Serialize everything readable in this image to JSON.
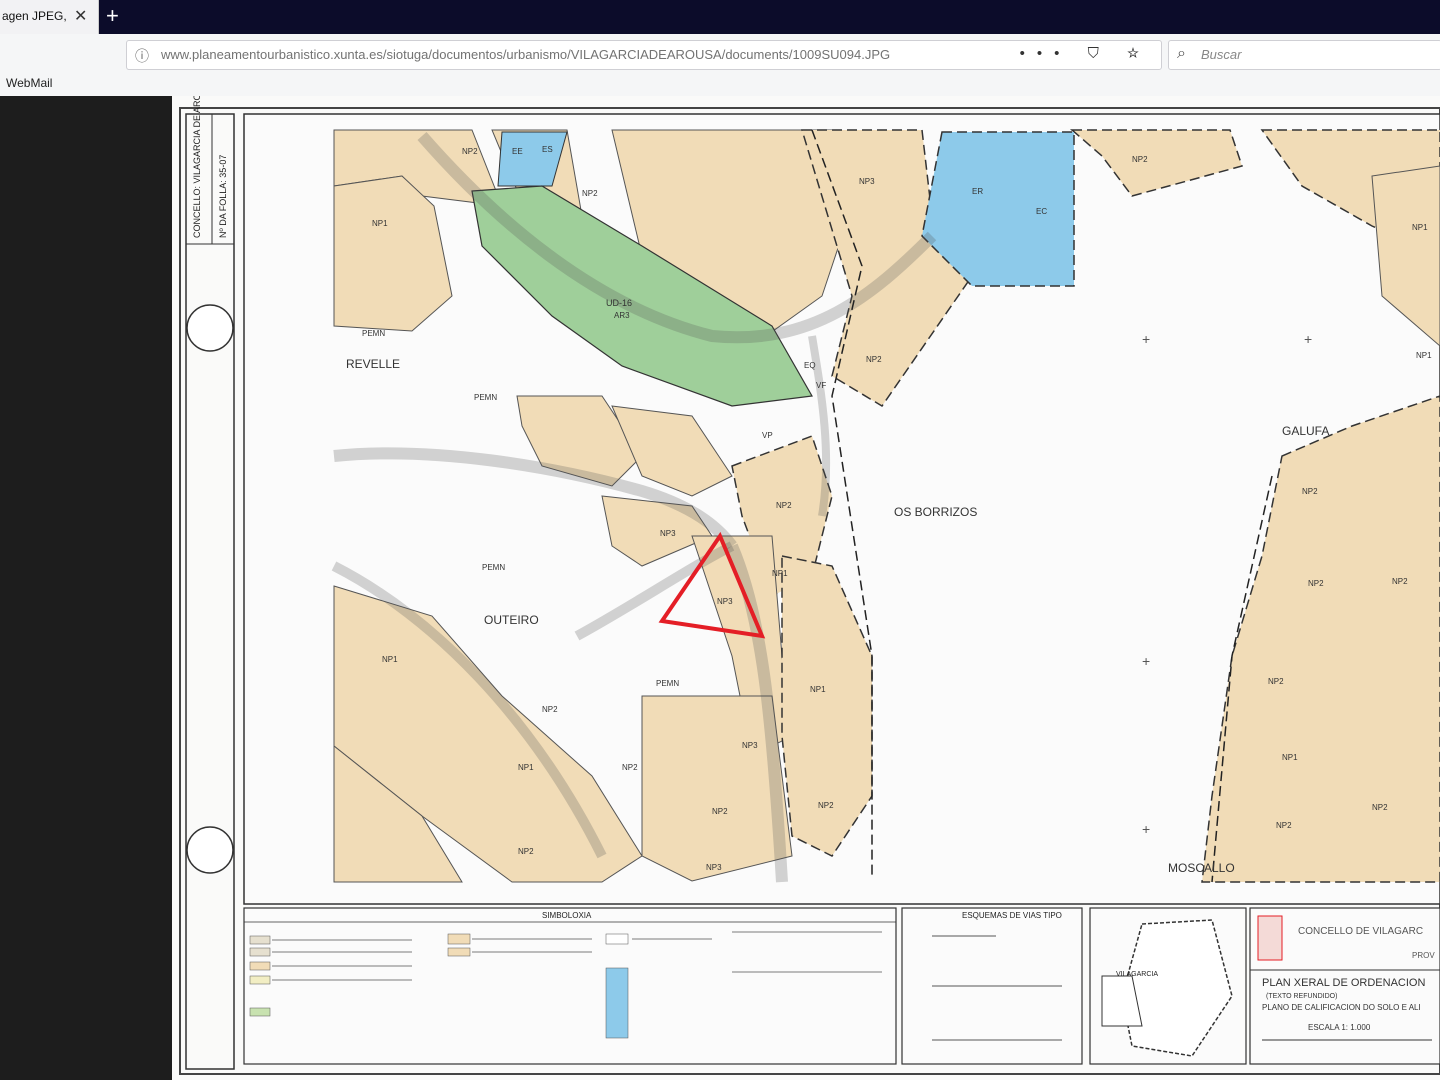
{
  "browser": {
    "tab_title": "agen JPEG,",
    "tab_close": "✕",
    "new_tab": "+",
    "url": "www.planeamentourbanistico.xunta.es/siotuga/documentos/urbanismo/VILAGARCIADEAROUSA/documents/1009SU094.JPG",
    "url_actions": "••• ⛉ ☆",
    "search_placeholder": "Buscar",
    "bookmark": "WebMail"
  },
  "map": {
    "title_block": "CONCELLO: VILAGARCIA DE AROUSA",
    "sheet": "Nº DA FOLLA: 35-07",
    "places": [
      "REVELLE",
      "OUTEIRO",
      "OS BORRIZOS",
      "GALUFA",
      "MOSCALLO"
    ],
    "zones": [
      "NP1",
      "NP2",
      "NP3",
      "UD-16",
      "AR3",
      "PEMN",
      "EE",
      "ES",
      "ER",
      "EC",
      "VP",
      "VF",
      "EQ"
    ],
    "legend_title": "SIMBOLOXIA",
    "road_schemes_title": "ESQUEMAS DE VIAS TIPO",
    "council": "CONCELLO DE VILAGARC",
    "plan_title": "PLAN XERAL DE ORDENACION",
    "plan_sub1": "(TEXTO REFUNDIDO)",
    "plan_sub2": "PLANO DE CALIFICACION DO SOLO E ALI",
    "scale": "ESCALA 1: 1.000",
    "prov": "PROV",
    "vilagarcia_label": "VILAGARCIA",
    "sample_labels": {
      "np1": "NP1",
      "np2": "NP2",
      "np3": "NP3",
      "ud": "UD-16",
      "ar3": "AR3",
      "pemn": "PEMN",
      "ee": "EE",
      "es": "ES",
      "er": "ER",
      "ec": "EC",
      "vp": "VP",
      "vf": "VF",
      "eq": "EQ",
      "np": "NP"
    }
  },
  "colors": {
    "tan": "#f1dcb7",
    "green": "#9fcf9a",
    "blue": "#8dcaea",
    "red": "#e41e26"
  }
}
